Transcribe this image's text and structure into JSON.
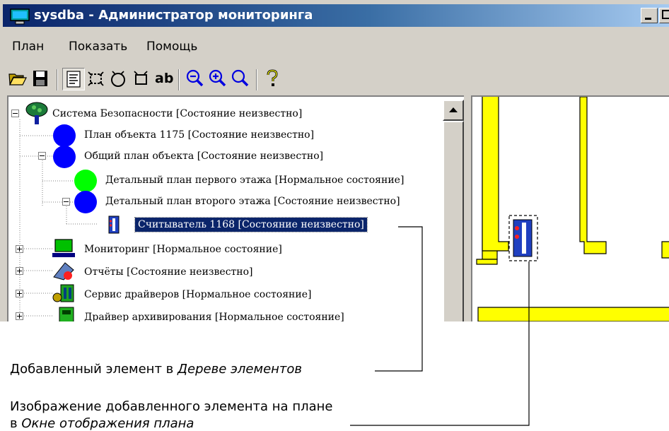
{
  "window": {
    "title": "sysdba - Администратор мониторинга",
    "menu": [
      "План",
      "Показать",
      "Помощь"
    ]
  },
  "toolbar": {
    "buttons": [
      {
        "icon": "open-folder-icon"
      },
      {
        "icon": "save-disk-icon"
      },
      {
        "icon": "element-tree-view-icon",
        "pressed": true
      },
      {
        "icon": "add-area-icon"
      },
      {
        "icon": "add-round-element-icon"
      },
      {
        "icon": "add-rect-element-icon"
      },
      {
        "icon": "text-label-icon",
        "label": "ab"
      },
      {
        "icon": "zoom-out-icon"
      },
      {
        "icon": "zoom-in-icon"
      },
      {
        "icon": "zoom-icon"
      },
      {
        "icon": "help-icon"
      }
    ]
  },
  "tree": {
    "items": [
      {
        "label": "Система Безопасности [Состояние неизвестно]",
        "icon": "security-system-tree-icon"
      },
      {
        "label": "План объекта 1175 [Состояние неизвестно]",
        "icon": "blue-circle-icon"
      },
      {
        "label": "Общий план объекта [Состояние неизвестно]",
        "icon": "blue-circle-icon"
      },
      {
        "label": "Детальный план первого этажа [Нормальное состояние]",
        "icon": "green-circle-icon"
      },
      {
        "label": "Детальный план второго этажа [Состояние неизвестно]",
        "icon": "blue-circle-icon"
      },
      {
        "label": "Считыватель 1168 [Состояние неизвестно]",
        "icon": "card-reader-icon",
        "selected": true
      },
      {
        "label": "Мониторинг [Нормальное состояние]",
        "icon": "monitor-icon"
      },
      {
        "label": "Отчёты [Состояние неизвестно]",
        "icon": "reports-icon"
      },
      {
        "label": "Сервис драйверов [Нормальное состояние]",
        "icon": "driver-service-icon"
      },
      {
        "label": "Драйвер архивирования [Нормальное состояние]",
        "icon": "archive-driver-icon"
      }
    ]
  },
  "callouts": {
    "tree_prefix": "Добавленный элемент в ",
    "tree_em": "Дереве элементов",
    "plan_line1": "Изображение добавленного элемента на плане",
    "plan_prefix": "в ",
    "plan_em": "Окне отображения плана"
  },
  "colors": {
    "title_bar": "#0a246a",
    "selection": "#0a246a",
    "plan_walls": "#ffff00",
    "node_blue": "#0000ff",
    "node_green": "#00ff00",
    "window_face": "#d4d0c8"
  }
}
